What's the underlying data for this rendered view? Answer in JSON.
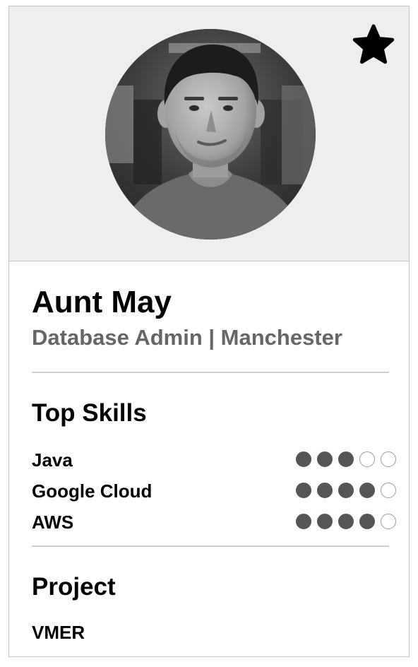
{
  "profile": {
    "name": "Aunt May",
    "subtitle": "Database Admin | Manchester",
    "favorite_icon": "star-icon",
    "avatar": "avatar-photo"
  },
  "skills": {
    "title": "Top Skills",
    "max_rating": 5,
    "items": [
      {
        "label": "Java",
        "rating": 3
      },
      {
        "label": "Google Cloud",
        "rating": 4
      },
      {
        "label": "AWS",
        "rating": 4
      }
    ]
  },
  "project": {
    "title": "Project",
    "name": "VMER"
  },
  "colors": {
    "hero_background": "#eeeeee",
    "subtitle": "#666666",
    "dot_filled": "#555555",
    "dot_empty_border": "#9a9a9a",
    "divider": "#cfcfcf",
    "card_border": "#c4c4c4"
  }
}
